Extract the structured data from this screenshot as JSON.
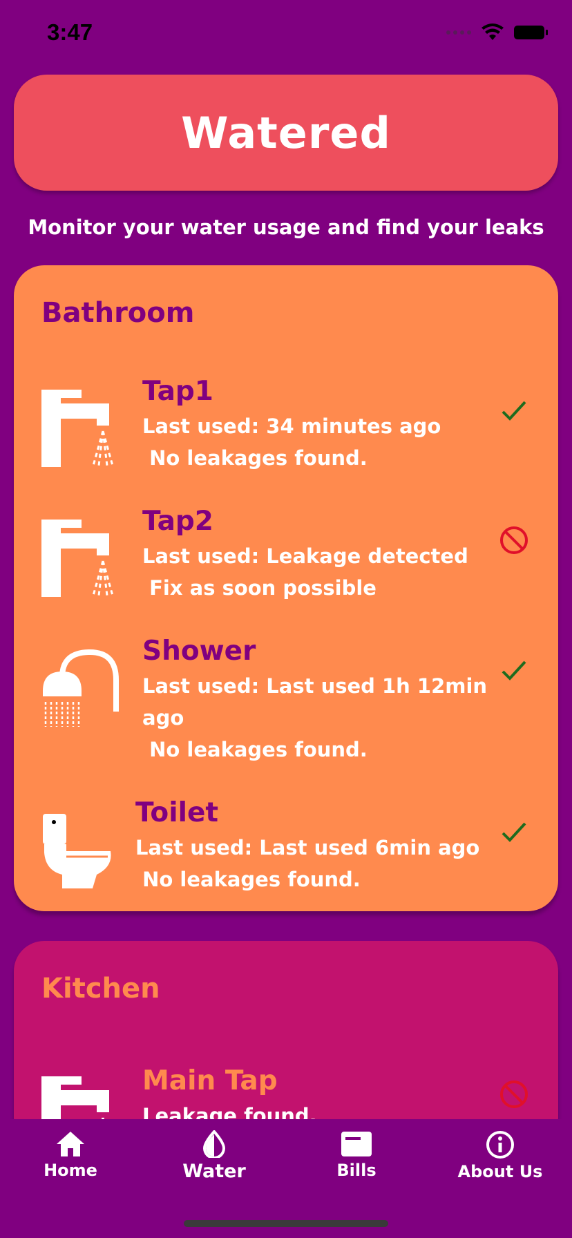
{
  "status_bar": {
    "time": "3:47"
  },
  "header": {
    "title": "Watered"
  },
  "subtitle": "Monitor your water usage and find your leaks",
  "bathroom": {
    "title": "Bathroom",
    "devices": [
      {
        "name": "Tap1",
        "line1": "Last used: 34 minutes ago",
        "line2": " No leakages found.",
        "icon": "tap-icon",
        "status": "ok"
      },
      {
        "name": "Tap2",
        "line1": "Last used: Leakage detected",
        "line2": " Fix as soon possible",
        "icon": "tap-icon",
        "status": "leak"
      },
      {
        "name": "Shower",
        "line1": "Last used: Last used 1h 12min",
        "line1b": "ago",
        "line2": " No leakages found.",
        "icon": "shower-icon",
        "status": "ok"
      },
      {
        "name": "Toilet",
        "line1": "Last used: Last used 6min ago",
        "line2": " No leakages found.",
        "icon": "toilet-icon",
        "status": "ok"
      }
    ]
  },
  "kitchen": {
    "title": "Kitchen",
    "devices": [
      {
        "name": "Main Tap",
        "line1": "Leakage found.",
        "icon": "tap-icon",
        "status": "leak"
      }
    ]
  },
  "nav": {
    "items": [
      {
        "label": "Home",
        "icon": "home-icon"
      },
      {
        "label": "Water",
        "icon": "water-drop-icon",
        "active": true
      },
      {
        "label": "Bills",
        "icon": "bills-icon"
      },
      {
        "label": "About Us",
        "icon": "info-icon"
      }
    ]
  },
  "colors": {
    "background": "#800080",
    "header": "#EE4F5D",
    "bathroom_card": "#FF8A4E",
    "kitchen_card": "#C2126E",
    "ok_check": "#1E6B1E",
    "leak_icon": "#E0102A"
  }
}
